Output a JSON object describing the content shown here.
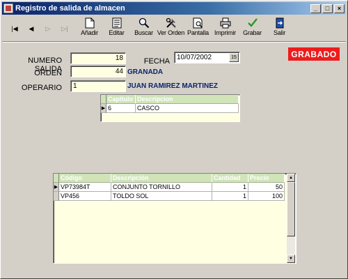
{
  "window": {
    "title": "Registro de salida de almacen",
    "controls": {
      "minimize": "_",
      "restore": "□",
      "close": "×"
    }
  },
  "toolbar": {
    "nav": [
      {
        "name": "first-record-button",
        "glyph": "|◀",
        "enabled": true
      },
      {
        "name": "previous-record-button",
        "glyph": "◀",
        "enabled": true
      },
      {
        "name": "next-record-button",
        "glyph": "▷",
        "enabled": false
      },
      {
        "name": "last-record-button",
        "glyph": "▷|",
        "enabled": false
      }
    ],
    "buttons": [
      {
        "name": "anadir-button",
        "icon": "new-document-icon",
        "label": "Añadir"
      },
      {
        "name": "editar-button",
        "icon": "edit-document-icon",
        "label": "Editar"
      },
      {
        "name": "buscar-button",
        "icon": "search-icon",
        "label": "Buscar"
      },
      {
        "name": "ver-orden-button",
        "icon": "tools-icon",
        "label": "Ver Orden"
      },
      {
        "name": "pantalla-button",
        "icon": "preview-icon",
        "label": "Pantalla"
      },
      {
        "name": "imprimir-button",
        "icon": "printer-icon",
        "label": "Imprimir"
      },
      {
        "name": "grabar-button",
        "icon": "checkmark-icon",
        "label": "Grabar"
      },
      {
        "name": "salir-button",
        "icon": "exit-icon",
        "label": "Salir"
      }
    ]
  },
  "form": {
    "numero_salida": {
      "label": "NUMERO SALIDA",
      "value": "18"
    },
    "orden": {
      "label": "ORDEN",
      "value": "44",
      "description": "GRANADA"
    },
    "operario": {
      "label": "OPERARIO",
      "value": "1",
      "name": "JUAN RAMIREZ MARTINEZ"
    },
    "fecha": {
      "label": "FECHA",
      "value": "10/07/2002",
      "button": "15"
    },
    "status_badge": "GRABADO"
  },
  "chapter_grid": {
    "columns": [
      "Capitulo",
      "Descripcion"
    ],
    "rows": [
      [
        "6",
        "CASCO"
      ]
    ]
  },
  "items_grid": {
    "columns": [
      "Código",
      "Descripción",
      "Cantidad",
      "Precio"
    ],
    "rows": [
      [
        "VP73984T",
        "CONJUNTO TORNILLO",
        "1",
        "50"
      ],
      [
        "VP456",
        "TOLDO SOL",
        "1",
        "100"
      ]
    ],
    "scrollbar": {
      "up": "▲",
      "down": "▼"
    }
  },
  "colors": {
    "badge": "#ee1c1c",
    "grid_header": "#d0e4b8",
    "field_background": "#ffffe1",
    "highlight_text": "#0a246a"
  }
}
